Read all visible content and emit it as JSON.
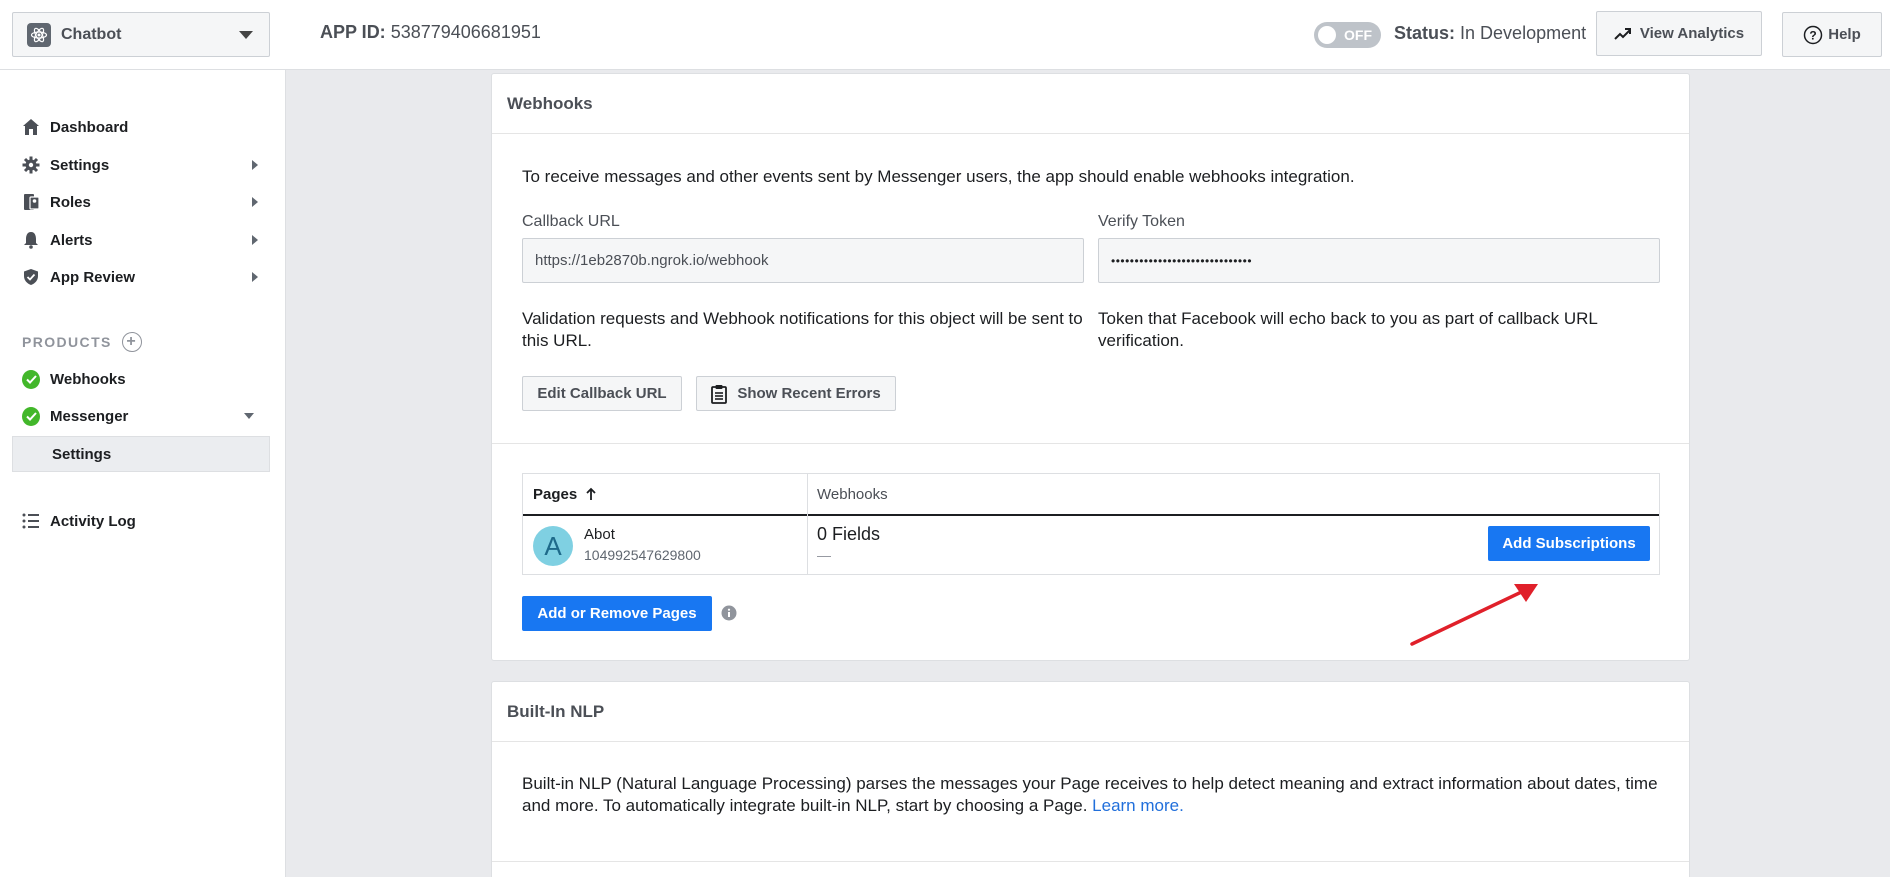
{
  "header": {
    "app_name": "Chatbot",
    "app_id_label": "APP ID:",
    "app_id_value": "538779406681951",
    "toggle_label": "OFF",
    "status_label": "Status:",
    "status_value": "In Development",
    "view_analytics_label": "View Analytics",
    "help_label": "Help"
  },
  "sidebar": {
    "items": [
      {
        "label": "Dashboard",
        "icon": "home-icon"
      },
      {
        "label": "Settings",
        "icon": "gear-icon"
      },
      {
        "label": "Roles",
        "icon": "roles-icon"
      },
      {
        "label": "Alerts",
        "icon": "bell-icon"
      },
      {
        "label": "App Review",
        "icon": "shield-icon"
      }
    ],
    "products_heading": "PRODUCTS",
    "products": [
      {
        "label": "Webhooks"
      },
      {
        "label": "Messenger"
      }
    ],
    "messenger_sub": "Settings",
    "activity_log": "Activity Log"
  },
  "webhooks": {
    "title": "Webhooks",
    "intro": "To receive messages and other events sent by Messenger users, the app should enable webhooks integration.",
    "callback_label": "Callback URL",
    "callback_value": "https://1eb2870b.ngrok.io/webhook",
    "verify_label": "Verify Token",
    "verify_value": "••••••••••••••••••••••••••••••",
    "callback_help": "Validation requests and Webhook notifications for this object will be sent to this URL.",
    "verify_help": "Token that Facebook will echo back to you as part of callback URL verification.",
    "edit_button": "Edit Callback URL",
    "errors_button": "Show Recent Errors",
    "table": {
      "col_pages": "Pages",
      "col_webhooks": "Webhooks",
      "rows": [
        {
          "avatar_letter": "A",
          "name": "Abot",
          "page_id": "104992547629800",
          "fields": "0 Fields",
          "fields_sub": "—",
          "action": "Add Subscriptions"
        }
      ]
    },
    "add_remove_button": "Add or Remove Pages"
  },
  "nlp": {
    "title": "Built-In NLP",
    "text": "Built-in NLP (Natural Language Processing) parses the messages your Page receives to help detect meaning and extract information about dates, time and more. To automatically integrate built-in NLP, start by choosing a Page.",
    "learn_more": "Learn more."
  },
  "colors": {
    "accent": "#1877f2",
    "success": "#42b72a",
    "annotation_arrow": "#e0202a"
  }
}
